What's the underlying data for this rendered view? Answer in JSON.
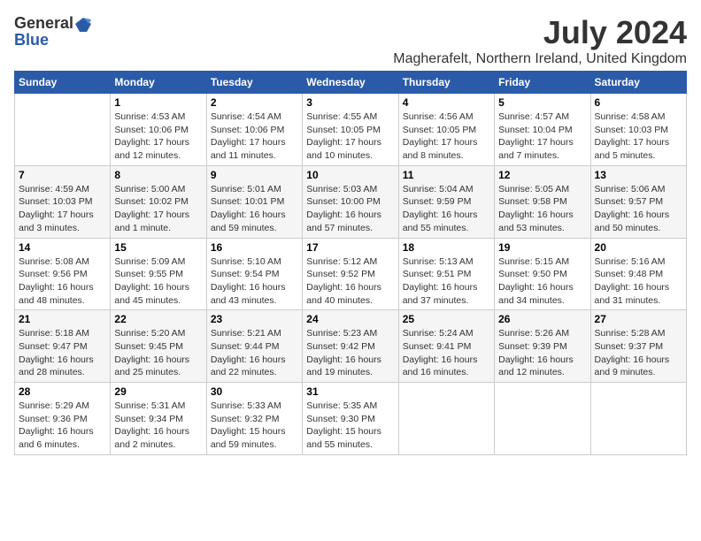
{
  "logo": {
    "general": "General",
    "blue": "Blue"
  },
  "title": "July 2024",
  "subtitle": "Magherafelt, Northern Ireland, United Kingdom",
  "headers": [
    "Sunday",
    "Monday",
    "Tuesday",
    "Wednesday",
    "Thursday",
    "Friday",
    "Saturday"
  ],
  "rows": [
    [
      {
        "date": "",
        "info": ""
      },
      {
        "date": "1",
        "info": "Sunrise: 4:53 AM\nSunset: 10:06 PM\nDaylight: 17 hours\nand 12 minutes."
      },
      {
        "date": "2",
        "info": "Sunrise: 4:54 AM\nSunset: 10:06 PM\nDaylight: 17 hours\nand 11 minutes."
      },
      {
        "date": "3",
        "info": "Sunrise: 4:55 AM\nSunset: 10:05 PM\nDaylight: 17 hours\nand 10 minutes."
      },
      {
        "date": "4",
        "info": "Sunrise: 4:56 AM\nSunset: 10:05 PM\nDaylight: 17 hours\nand 8 minutes."
      },
      {
        "date": "5",
        "info": "Sunrise: 4:57 AM\nSunset: 10:04 PM\nDaylight: 17 hours\nand 7 minutes."
      },
      {
        "date": "6",
        "info": "Sunrise: 4:58 AM\nSunset: 10:03 PM\nDaylight: 17 hours\nand 5 minutes."
      }
    ],
    [
      {
        "date": "7",
        "info": "Sunrise: 4:59 AM\nSunset: 10:03 PM\nDaylight: 17 hours\nand 3 minutes."
      },
      {
        "date": "8",
        "info": "Sunrise: 5:00 AM\nSunset: 10:02 PM\nDaylight: 17 hours\nand 1 minute."
      },
      {
        "date": "9",
        "info": "Sunrise: 5:01 AM\nSunset: 10:01 PM\nDaylight: 16 hours\nand 59 minutes."
      },
      {
        "date": "10",
        "info": "Sunrise: 5:03 AM\nSunset: 10:00 PM\nDaylight: 16 hours\nand 57 minutes."
      },
      {
        "date": "11",
        "info": "Sunrise: 5:04 AM\nSunset: 9:59 PM\nDaylight: 16 hours\nand 55 minutes."
      },
      {
        "date": "12",
        "info": "Sunrise: 5:05 AM\nSunset: 9:58 PM\nDaylight: 16 hours\nand 53 minutes."
      },
      {
        "date": "13",
        "info": "Sunrise: 5:06 AM\nSunset: 9:57 PM\nDaylight: 16 hours\nand 50 minutes."
      }
    ],
    [
      {
        "date": "14",
        "info": "Sunrise: 5:08 AM\nSunset: 9:56 PM\nDaylight: 16 hours\nand 48 minutes."
      },
      {
        "date": "15",
        "info": "Sunrise: 5:09 AM\nSunset: 9:55 PM\nDaylight: 16 hours\nand 45 minutes."
      },
      {
        "date": "16",
        "info": "Sunrise: 5:10 AM\nSunset: 9:54 PM\nDaylight: 16 hours\nand 43 minutes."
      },
      {
        "date": "17",
        "info": "Sunrise: 5:12 AM\nSunset: 9:52 PM\nDaylight: 16 hours\nand 40 minutes."
      },
      {
        "date": "18",
        "info": "Sunrise: 5:13 AM\nSunset: 9:51 PM\nDaylight: 16 hours\nand 37 minutes."
      },
      {
        "date": "19",
        "info": "Sunrise: 5:15 AM\nSunset: 9:50 PM\nDaylight: 16 hours\nand 34 minutes."
      },
      {
        "date": "20",
        "info": "Sunrise: 5:16 AM\nSunset: 9:48 PM\nDaylight: 16 hours\nand 31 minutes."
      }
    ],
    [
      {
        "date": "21",
        "info": "Sunrise: 5:18 AM\nSunset: 9:47 PM\nDaylight: 16 hours\nand 28 minutes."
      },
      {
        "date": "22",
        "info": "Sunrise: 5:20 AM\nSunset: 9:45 PM\nDaylight: 16 hours\nand 25 minutes."
      },
      {
        "date": "23",
        "info": "Sunrise: 5:21 AM\nSunset: 9:44 PM\nDaylight: 16 hours\nand 22 minutes."
      },
      {
        "date": "24",
        "info": "Sunrise: 5:23 AM\nSunset: 9:42 PM\nDaylight: 16 hours\nand 19 minutes."
      },
      {
        "date": "25",
        "info": "Sunrise: 5:24 AM\nSunset: 9:41 PM\nDaylight: 16 hours\nand 16 minutes."
      },
      {
        "date": "26",
        "info": "Sunrise: 5:26 AM\nSunset: 9:39 PM\nDaylight: 16 hours\nand 12 minutes."
      },
      {
        "date": "27",
        "info": "Sunrise: 5:28 AM\nSunset: 9:37 PM\nDaylight: 16 hours\nand 9 minutes."
      }
    ],
    [
      {
        "date": "28",
        "info": "Sunrise: 5:29 AM\nSunset: 9:36 PM\nDaylight: 16 hours\nand 6 minutes."
      },
      {
        "date": "29",
        "info": "Sunrise: 5:31 AM\nSunset: 9:34 PM\nDaylight: 16 hours\nand 2 minutes."
      },
      {
        "date": "30",
        "info": "Sunrise: 5:33 AM\nSunset: 9:32 PM\nDaylight: 15 hours\nand 59 minutes."
      },
      {
        "date": "31",
        "info": "Sunrise: 5:35 AM\nSunset: 9:30 PM\nDaylight: 15 hours\nand 55 minutes."
      },
      {
        "date": "",
        "info": ""
      },
      {
        "date": "",
        "info": ""
      },
      {
        "date": "",
        "info": ""
      }
    ]
  ]
}
